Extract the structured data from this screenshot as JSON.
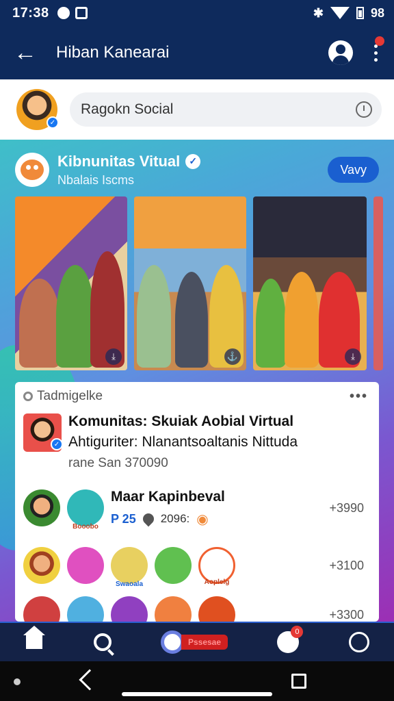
{
  "status_bar": {
    "time": "17:38",
    "battery": "98"
  },
  "app_bar": {
    "title": "Hiban Kanearai"
  },
  "search": {
    "text": "Ragokn Social"
  },
  "community": {
    "name": "Kibnunitas Vitual",
    "subtitle": "Nbalais Iscms",
    "view_button": "Vavy"
  },
  "card": {
    "tag": "Tadmigelke",
    "post_title": "Komunitas: Skuiak Aobial Virtual",
    "post_line2": "Ahtiguriter: Nlanantsoaltanis Nittuda",
    "post_line3": "rane San 370090",
    "rows": [
      {
        "label": "Maar Kapinbeval",
        "meta_blue": "P 25",
        "meta_date": "2096:",
        "mini_label": "Booobo",
        "value": "+3990"
      },
      {
        "value": "+3100",
        "mini_label_a": "Swaoala",
        "mini_label_b": "Aoplelg"
      },
      {
        "value": "+3300"
      }
    ]
  },
  "bottom_nav": {
    "promo": "Pssesae",
    "badge": "0"
  },
  "colors": {
    "primary": "#0e2a5c",
    "accent": "#1a5fd0",
    "badge": "#e53935"
  }
}
